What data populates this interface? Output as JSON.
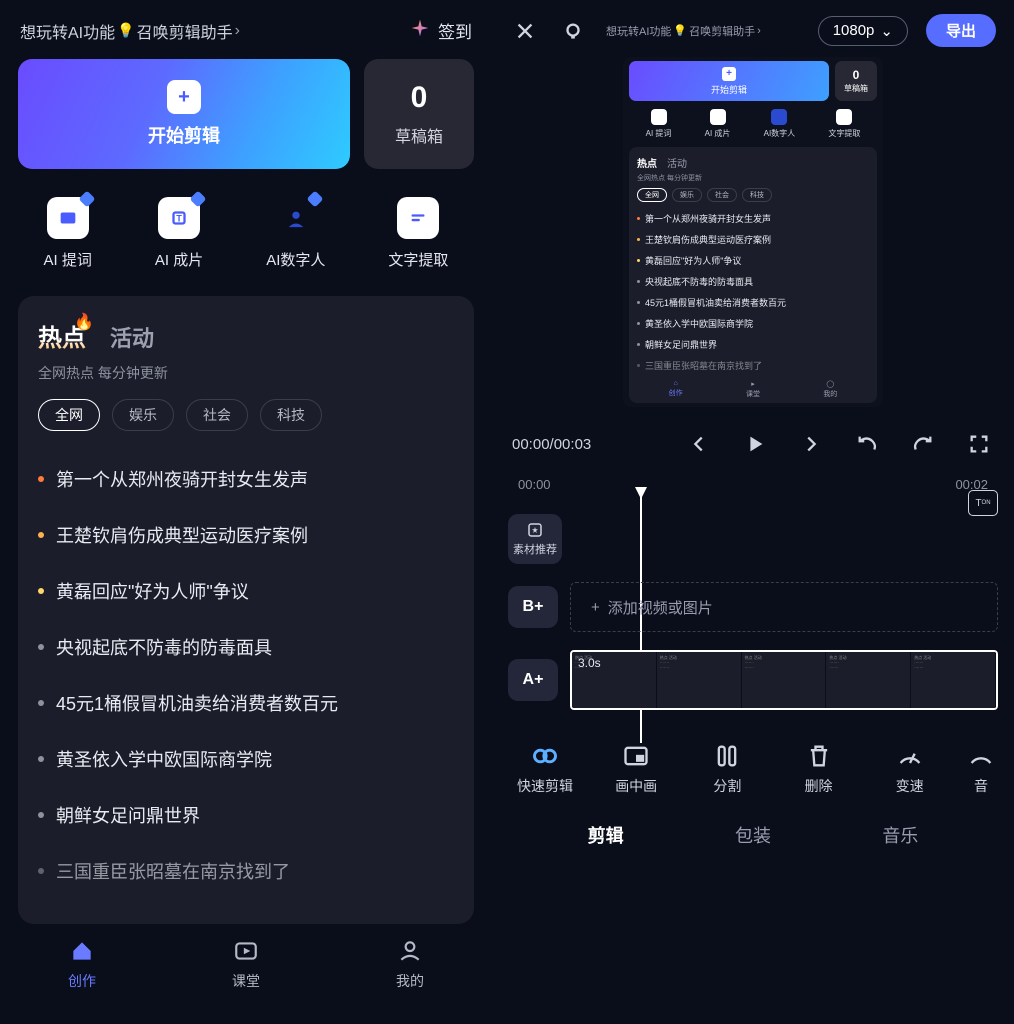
{
  "left": {
    "assist_tip": "想玩转AI功能",
    "assist_tip2": "召唤剪辑助手",
    "checkin": "签到",
    "hero_start": "开始剪辑",
    "draft_count": "0",
    "draft_label": "草稿箱",
    "features": [
      "AI 提词",
      "AI 成片",
      "AI数字人",
      "文字提取"
    ],
    "trend_tabs": {
      "hot": "热点",
      "activity": "活动"
    },
    "trend_sub": "全网热点 每分钟更新",
    "pills": [
      "全网",
      "娱乐",
      "社会",
      "科技"
    ],
    "trend_items": [
      "第一个从郑州夜骑开封女生发声",
      "王楚钦肩伤成典型运动医疗案例",
      "黄磊回应\"好为人师\"争议",
      "央视起底不防毒的防毒面具",
      "45元1桶假冒机油卖给消费者数百元",
      "黄圣依入学中欧国际商学院",
      "朝鲜女足问鼎世界",
      "三国重臣张昭墓在南京找到了"
    ],
    "dot_colors": [
      "#ff7b3a",
      "#ffb14d",
      "#ffd66b",
      "#8e91a0",
      "#8e91a0",
      "#8e91a0",
      "#8e91a0",
      "#8e91a0"
    ],
    "nav": [
      "创作",
      "课堂",
      "我的"
    ]
  },
  "right": {
    "assist_tip": "想玩转AI功能",
    "assist_tip2": "召唤剪辑助手",
    "resolution": "1080p",
    "export": "导出",
    "preview": {
      "hero_start": "开始剪辑",
      "draft_count": "0",
      "draft_label": "草稿箱",
      "features": [
        "AI 提词",
        "AI 成片",
        "AI数字人",
        "文字提取"
      ],
      "trend_hot": "热点",
      "trend_activity": "活动",
      "trend_sub": "全网热点 每分钟更新",
      "pills": [
        "全网",
        "娱乐",
        "社会",
        "科技"
      ],
      "nav": [
        "创作",
        "课堂",
        "我的"
      ]
    },
    "time_current": "00:00",
    "time_total": "00:03",
    "time_divider": "/",
    "ruler_start": "00:00",
    "ruler_end": "00:02",
    "material_rec": "素材推荐",
    "bplus": "B+",
    "aplus": "A+",
    "add_media": "添加视频或图片",
    "clip_duration": "3.0s",
    "tools": [
      "快速剪辑",
      "画中画",
      "分割",
      "删除",
      "变速",
      "音"
    ],
    "modes": [
      "剪辑",
      "包装",
      "音乐"
    ],
    "caption_toggle": "T"
  }
}
